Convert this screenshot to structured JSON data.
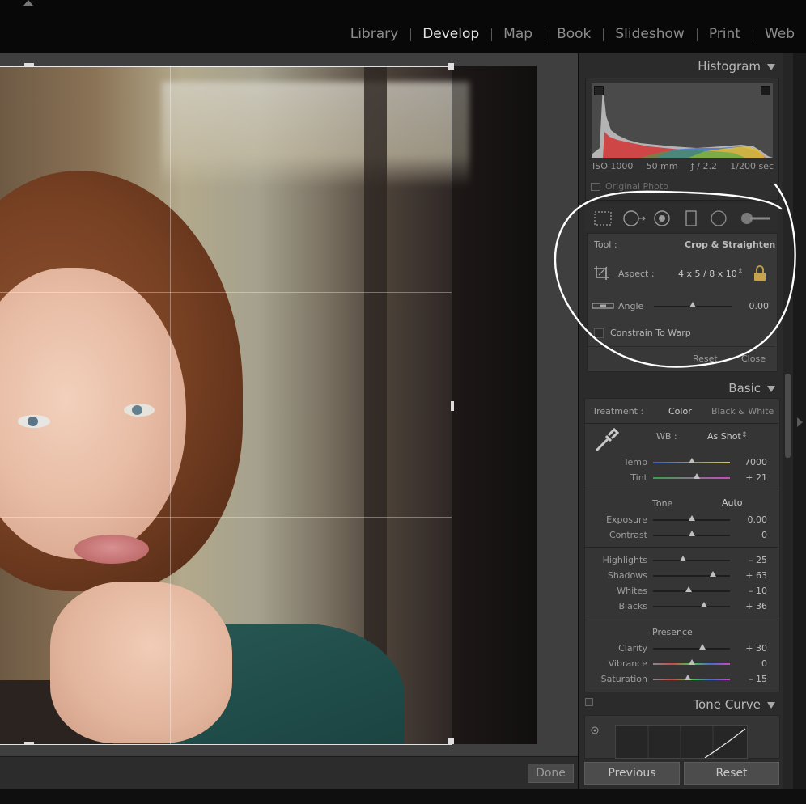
{
  "modules": [
    "Library",
    "Develop",
    "Map",
    "Book",
    "Slideshow",
    "Print",
    "Web"
  ],
  "active_module": "Develop",
  "toolbar": {
    "done_label": "Done"
  },
  "histogram": {
    "title": "Histogram",
    "iso": "ISO 1000",
    "focal": "50 mm",
    "aperture": "ƒ / 2.2",
    "shutter": "1/200 sec",
    "original_photo": "Original Photo"
  },
  "crop": {
    "tool_label": "Tool :",
    "tool_value": "Crop & Straighten",
    "aspect_label": "Aspect :",
    "aspect_value": "4 x 5  /  8 x 10",
    "angle_label": "Angle",
    "angle_value": "0.00",
    "angle_level": 0.5,
    "constrain_label": "Constrain To Warp",
    "reset_label": "Reset",
    "close_label": "Close"
  },
  "basic": {
    "title": "Basic",
    "treatment_label": "Treatment :",
    "treatment_color": "Color",
    "treatment_bw": "Black & White",
    "wb_label": "WB :",
    "wb_value": "As Shot",
    "tone_label": "Tone",
    "auto_label": "Auto",
    "presence_label": "Presence",
    "wb_sliders": [
      {
        "label": "Temp",
        "value": "7000",
        "level": 0.5
      },
      {
        "label": "Tint",
        "value": "+ 21",
        "level": 0.57
      }
    ],
    "tone_sliders": [
      {
        "label": "Exposure",
        "value": "0.00",
        "level": 0.5
      },
      {
        "label": "Contrast",
        "value": "0",
        "level": 0.5
      }
    ],
    "tone_sliders2": [
      {
        "label": "Highlights",
        "value": "– 25",
        "level": 0.39
      },
      {
        "label": "Shadows",
        "value": "+ 63",
        "level": 0.78
      },
      {
        "label": "Whites",
        "value": "– 10",
        "level": 0.46
      },
      {
        "label": "Blacks",
        "value": "+ 36",
        "level": 0.66
      }
    ],
    "presence_sliders": [
      {
        "label": "Clarity",
        "value": "+ 30",
        "level": 0.64
      },
      {
        "label": "Vibrance",
        "value": "0",
        "level": 0.5
      },
      {
        "label": "Saturation",
        "value": "– 15",
        "level": 0.45
      }
    ]
  },
  "tone_curve": {
    "title": "Tone Curve"
  },
  "bottom_buttons": {
    "previous": "Previous",
    "reset": "Reset"
  },
  "colors": {
    "annotation": "#ffffff",
    "panel": "#2b2b2b",
    "accent_text": "#e2e2e2"
  }
}
